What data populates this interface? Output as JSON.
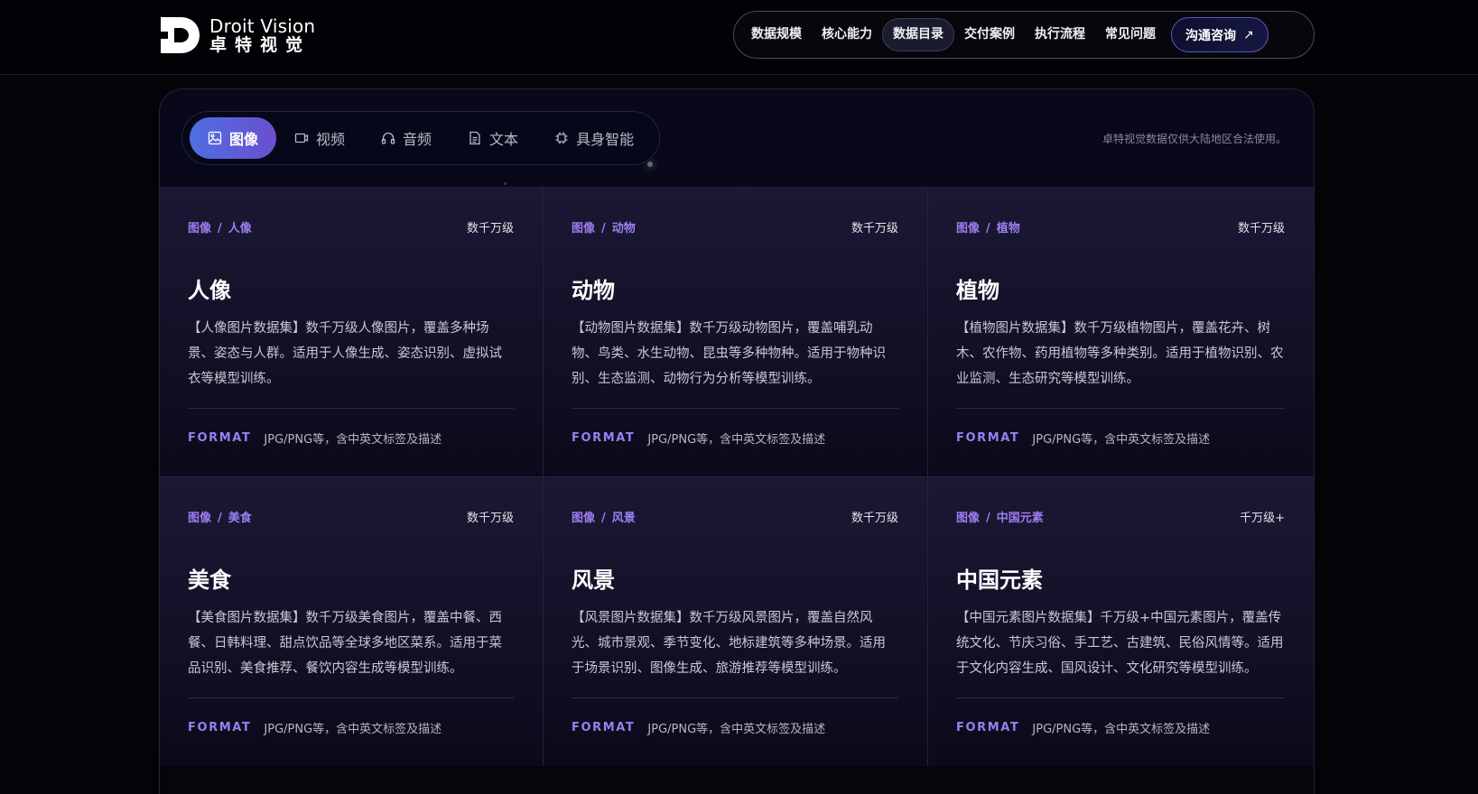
{
  "brand": {
    "name_en": "Droit Vision",
    "name_cn": "卓特视觉"
  },
  "nav": {
    "items": [
      "数据规模",
      "核心能力",
      "数据目录",
      "交付案例",
      "执行流程",
      "常见问题"
    ],
    "active_index": 2,
    "cta_label": "沟通咨询"
  },
  "tabs": {
    "items": [
      {
        "label": "图像",
        "icon": "image-icon"
      },
      {
        "label": "视频",
        "icon": "video-icon"
      },
      {
        "label": "音频",
        "icon": "headphones-icon"
      },
      {
        "label": "文本",
        "icon": "document-icon"
      },
      {
        "label": "具身智能",
        "icon": "chip-icon"
      }
    ],
    "active_index": 0
  },
  "notice": "卓特视觉数据仅供大陆地区合法使用。",
  "format_key": "FORMAT",
  "cards": [
    {
      "category": "图像",
      "sub": "人像",
      "scale": "数千万级",
      "title": "人像",
      "desc": "【人像图片数据集】数千万级人像图片，覆盖多种场景、姿态与人群。适用于人像生成、姿态识别、虚拟试衣等模型训练。",
      "format": "JPG/PNG等，含中英文标签及描述"
    },
    {
      "category": "图像",
      "sub": "动物",
      "scale": "数千万级",
      "title": "动物",
      "desc": "【动物图片数据集】数千万级动物图片，覆盖哺乳动物、鸟类、水生动物、昆虫等多种物种。适用于物种识别、生态监测、动物行为分析等模型训练。",
      "format": "JPG/PNG等，含中英文标签及描述"
    },
    {
      "category": "图像",
      "sub": "植物",
      "scale": "数千万级",
      "title": "植物",
      "desc": "【植物图片数据集】数千万级植物图片，覆盖花卉、树木、农作物、药用植物等多种类别。适用于植物识别、农业监测、生态研究等模型训练。",
      "format": "JPG/PNG等，含中英文标签及描述"
    },
    {
      "category": "图像",
      "sub": "美食",
      "scale": "数千万级",
      "title": "美食",
      "desc": "【美食图片数据集】数千万级美食图片，覆盖中餐、西餐、日韩料理、甜点饮品等全球多地区菜系。适用于菜品识别、美食推荐、餐饮内容生成等模型训练。",
      "format": "JPG/PNG等，含中英文标签及描述"
    },
    {
      "category": "图像",
      "sub": "风景",
      "scale": "数千万级",
      "title": "风景",
      "desc": "【风景图片数据集】数千万级风景图片，覆盖自然风光、城市景观、季节变化、地标建筑等多种场景。适用于场景识别、图像生成、旅游推荐等模型训练。",
      "format": "JPG/PNG等，含中英文标签及描述"
    },
    {
      "category": "图像",
      "sub": "中国元素",
      "scale": "千万级+",
      "title": "中国元素",
      "desc": "【中国元素图片数据集】千万级+中国元素图片，覆盖传统文化、节庆习俗、手工艺、古建筑、民俗风情等。适用于文化内容生成、国风设计、文化研究等模型训练。",
      "format": "JPG/PNG等，含中英文标签及描述"
    }
  ]
}
